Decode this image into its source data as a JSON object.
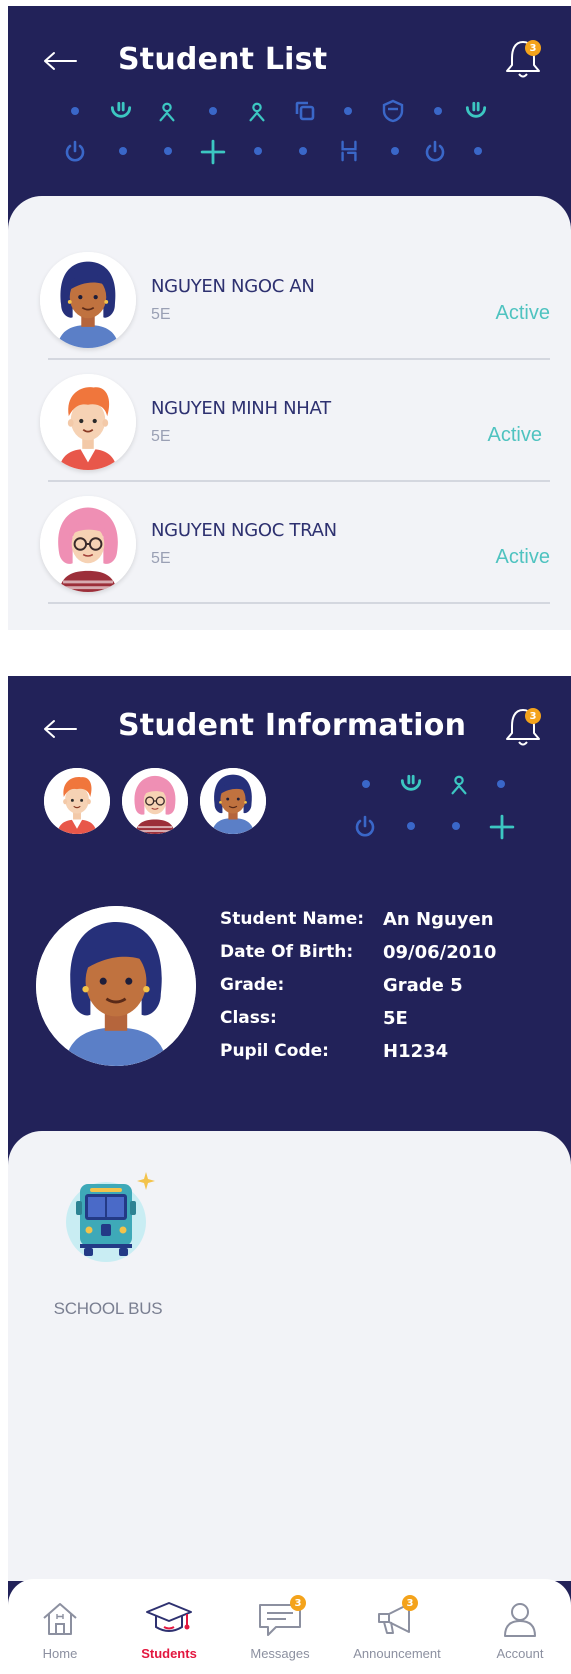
{
  "student_list": {
    "title": "Student List",
    "notification_count": "3",
    "students": [
      {
        "name": "NGUYEN NGOC AN",
        "class": "5E",
        "status": "Active"
      },
      {
        "name": "NGUYEN MINH NHAT",
        "class": "5E",
        "status": "Active"
      },
      {
        "name": "NGUYEN NGOC TRAN",
        "class": "5E",
        "status": "Active"
      }
    ]
  },
  "student_info": {
    "title": "Student Information",
    "notification_count": "3",
    "fields": [
      {
        "label": "Student Name:",
        "value": "An Nguyen"
      },
      {
        "label": "Date Of Birth:",
        "value": "09/06/2010"
      },
      {
        "label": "Grade:",
        "value": "Grade 5"
      },
      {
        "label": "Class:",
        "value": "5E"
      },
      {
        "label": "Pupil Code:",
        "value": "H1234"
      }
    ],
    "services": [
      {
        "label": "SCHOOL BUS",
        "icon": "school-bus-icon"
      }
    ]
  },
  "tabbar": {
    "tabs": [
      {
        "label": "Home",
        "icon": "home-icon",
        "badge": null
      },
      {
        "label": "Students",
        "icon": "graduation-cap-icon",
        "badge": null
      },
      {
        "label": "Messages",
        "icon": "chat-icon",
        "badge": "3"
      },
      {
        "label": "Announcement",
        "icon": "megaphone-icon",
        "badge": "3"
      },
      {
        "label": "Account",
        "icon": "user-icon",
        "badge": null
      }
    ],
    "active": "Students"
  },
  "colors": {
    "header_bg": "#222259",
    "card_bg": "#f2f3f7",
    "active_status": "#4fc3c0",
    "active_tab": "#e3173f",
    "badge": "#f4a31b",
    "pattern_teal": "#3cc7c2",
    "pattern_blue": "#3a67c8"
  }
}
